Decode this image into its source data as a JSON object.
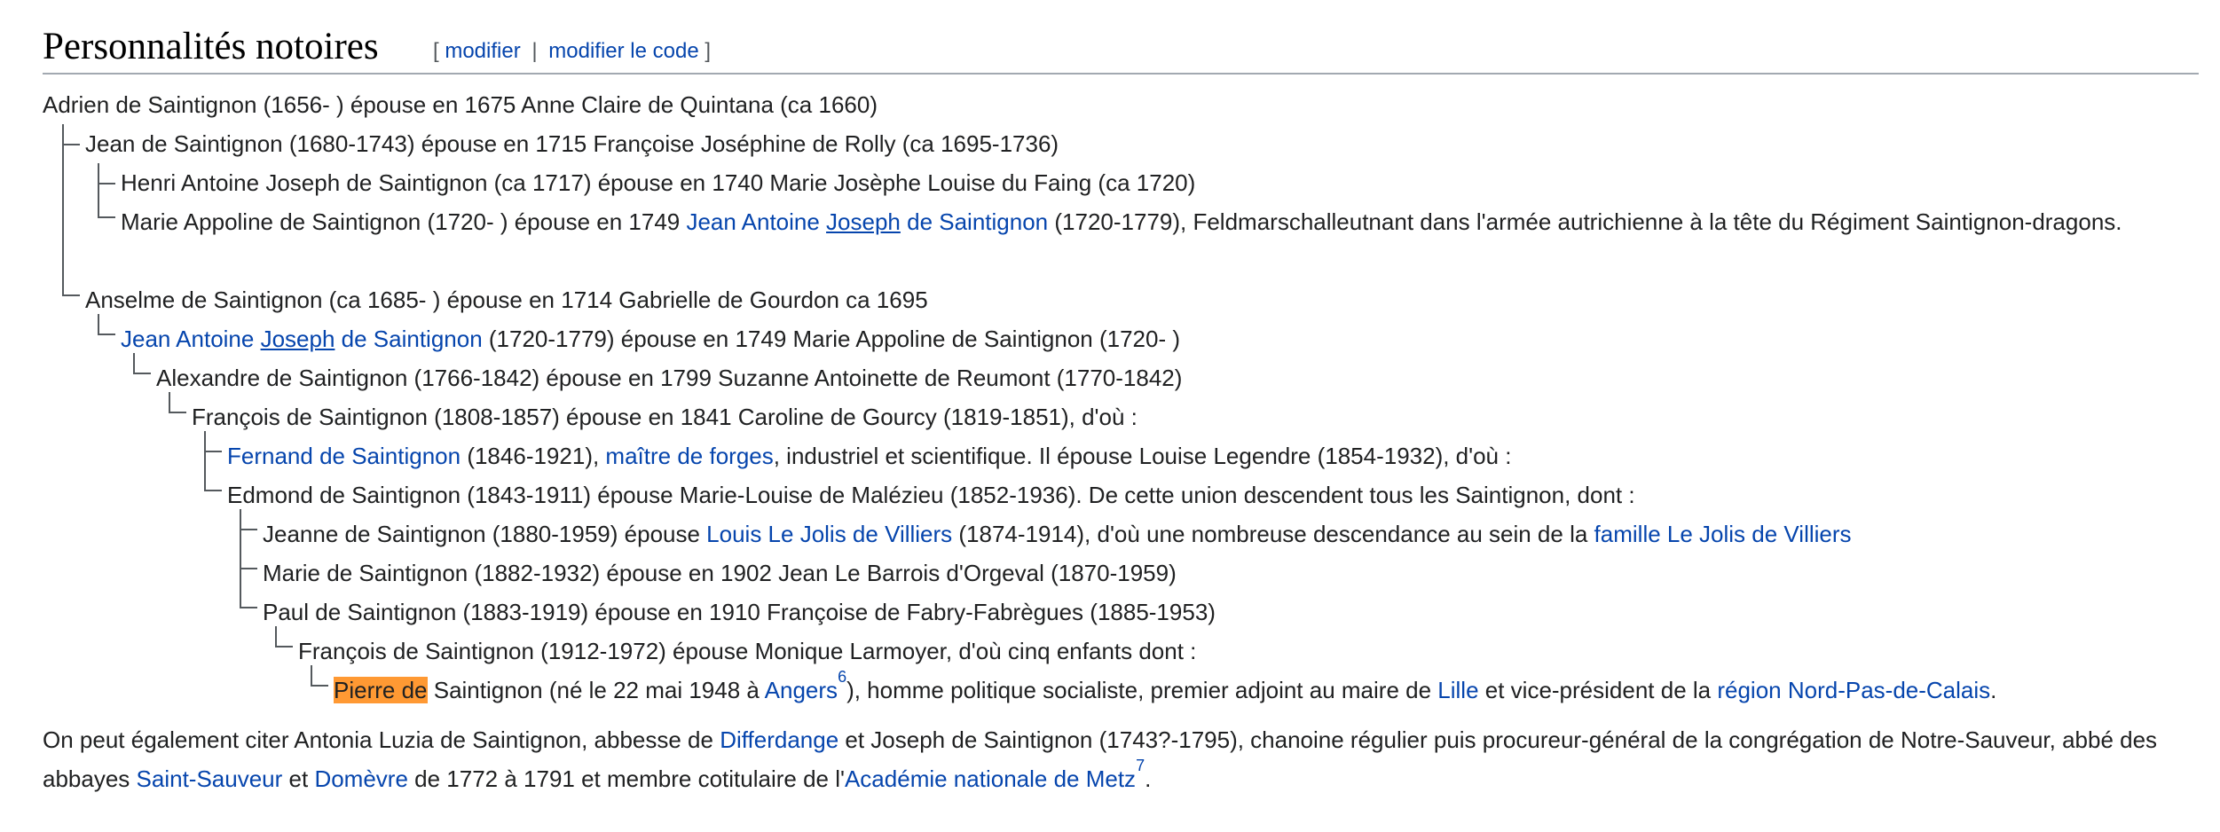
{
  "section": {
    "title": "Personnalités notoires",
    "edit_open": "[",
    "edit_label": "modifier",
    "edit_sep": "|",
    "edit_code_label": "modifier le code",
    "edit_close": "]"
  },
  "tree": {
    "r1": "Adrien de Saintignon (1656- ) épouse en 1675 Anne Claire de Quintana (ca 1660)",
    "r2": "Jean de Saintignon (1680-1743) épouse en 1715 Françoise Joséphine de Rolly (ca 1695-1736)",
    "r3": "Henri Antoine Joseph de Saintignon (ca 1717) épouse en 1740 Marie Josèphe Louise du Faing (ca 1720)",
    "r4_a": "Marie Appoline de Saintignon (1720- ) épouse en 1749 ",
    "r4_link1": "Jean Antoine ",
    "r4_link2": "Joseph",
    "r4_link3": " de Saintignon",
    "r4_b": " (1720-1779), Feldmarschalleutnant dans l'armée autrichienne à la tête du Régiment Saintignon-dragons.",
    "r5": "Anselme de Saintignon (ca 1685- ) épouse en 1714 Gabrielle de Gourdon ca 1695",
    "r6_link1": "Jean Antoine ",
    "r6_link2": "Joseph",
    "r6_link3": " de Saintignon",
    "r6_b": " (1720-1779) épouse en 1749 Marie Appoline de Saintignon (1720- )",
    "r7": "Alexandre de Saintignon (1766-1842) épouse en 1799 Suzanne Antoinette de Reumont (1770-1842)",
    "r8": "François de Saintignon (1808-1857) épouse en 1841 Caroline de Gourcy (1819-1851), d'où :",
    "r9_link": "Fernand de Saintignon",
    "r9_a": " (1846-1921), ",
    "r9_link2": "maître de forges",
    "r9_b": ", industriel et scientifique. Il épouse Louise Legendre (1854-1932), d'où :",
    "r10": "Edmond de Saintignon (1843-1911) épouse Marie-Louise de Malézieu (1852-1936). De cette union descendent tous les Saintignon, dont :",
    "r11_a": "Jeanne de Saintignon (1880-1959) épouse ",
    "r11_link": "Louis Le Jolis de Villiers",
    "r11_b": " (1874-1914), d'où une nombreuse descendance au sein de la ",
    "r11_link2": "famille Le Jolis de Villiers",
    "r12": "Marie de Saintignon (1882-1932) épouse en 1902 Jean Le Barrois d'Orgeval (1870-1959)",
    "r13": "Paul de Saintignon (1883-1919) épouse en 1910 Françoise de Fabry-Fabrègues (1885-1953)",
    "r14": "François de Saintignon (1912-1972) épouse Monique Larmoyer, d'où cinq enfants dont :",
    "r15_hl": "Pierre de",
    "r15_a": " Saintignon (né le 22 mai 1948 à ",
    "r15_link": "Angers",
    "r15_sup": "6",
    "r15_b": "), homme politique socialiste, premier adjoint au maire de ",
    "r15_link2": "Lille",
    "r15_c": " et vice-président de la ",
    "r15_link3": "région Nord-Pas-de-Calais",
    "r15_d": "."
  },
  "para": {
    "a": "On peut également citer Antonia Luzia de Saintignon, abbesse de ",
    "link1": "Differdange",
    "b": " et Joseph de Saintignon (1743?-1795), chanoine régulier puis procureur-général de la congrégation de Notre-Sauveur, abbé des abbayes ",
    "link2": "Saint-Sauveur",
    "c": " et ",
    "link3": "Domèvre",
    "d": " de 1772 à 1791 et membre cotitulaire de l'",
    "link4": "Académie nationale de Metz",
    "sup": "7",
    "e": "."
  }
}
